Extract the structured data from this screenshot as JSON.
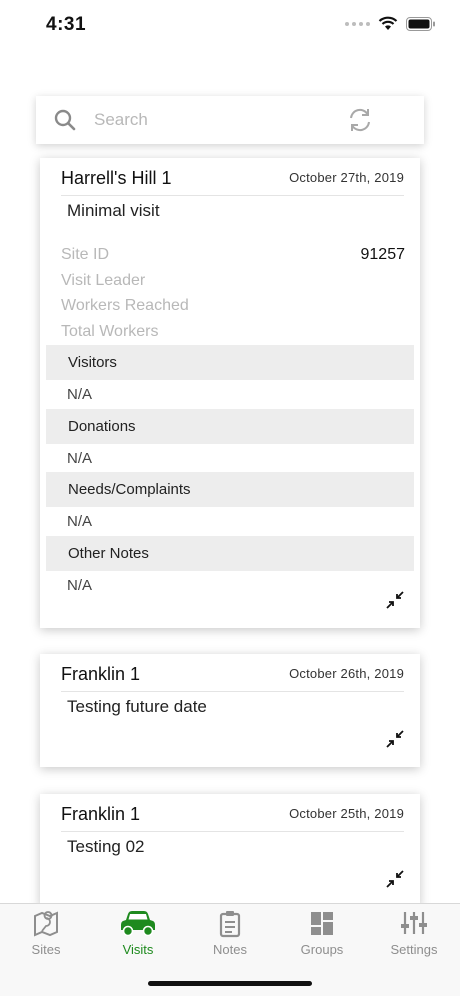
{
  "status_bar": {
    "time": "4:31"
  },
  "search": {
    "placeholder": "Search"
  },
  "cards": [
    {
      "title": "Harrell's Hill 1",
      "date": "October 27th, 2019",
      "subtitle": "Minimal visit",
      "fields": [
        {
          "label": "Site ID",
          "value": "91257"
        },
        {
          "label": "Visit Leader",
          "value": ""
        },
        {
          "label": "Workers Reached",
          "value": ""
        },
        {
          "label": "Total Workers",
          "value": ""
        }
      ],
      "sections": [
        {
          "header": "Visitors",
          "value": "N/A"
        },
        {
          "header": "Donations",
          "value": "N/A"
        },
        {
          "header": "Needs/Complaints",
          "value": "N/A"
        },
        {
          "header": "Other Notes",
          "value": "N/A"
        }
      ]
    },
    {
      "title": "Franklin 1",
      "date": "October 26th, 2019",
      "subtitle": "Testing future date"
    },
    {
      "title": "Franklin 1",
      "date": "October 25th, 2019",
      "subtitle": "Testing 02"
    }
  ],
  "tabs": [
    {
      "label": "Sites",
      "icon": "map-icon"
    },
    {
      "label": "Visits",
      "icon": "car-icon"
    },
    {
      "label": "Notes",
      "icon": "clipboard-icon"
    },
    {
      "label": "Groups",
      "icon": "grid-icon"
    },
    {
      "label": "Settings",
      "icon": "sliders-icon"
    }
  ],
  "colors": {
    "active_tab": "#1e8a1e",
    "inactive_tab": "#8e8e8e",
    "section_bg": "#ededed"
  }
}
